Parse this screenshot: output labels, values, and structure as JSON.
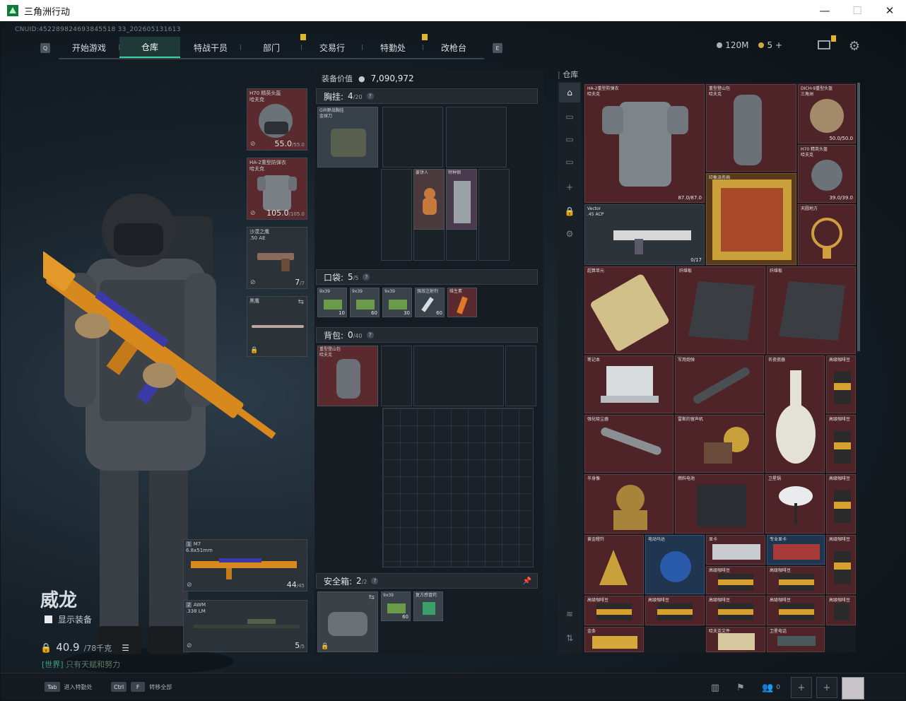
{
  "window": {
    "title": "三角洲行动",
    "min": "—",
    "max": "☐",
    "close": "✕"
  },
  "uid": "CNUID:452289824693845518 33_202605131613",
  "nav": {
    "left_key": "Q",
    "right_key": "E",
    "tabs": [
      {
        "label": "开始游戏"
      },
      {
        "label": "仓库"
      },
      {
        "label": "特战干员"
      },
      {
        "label": "部门"
      },
      {
        "label": "交易行"
      },
      {
        "label": "特勤处"
      },
      {
        "label": "改枪台"
      }
    ],
    "active_tab": "仓库"
  },
  "currency": {
    "silver": "120M",
    "gold": "5",
    "add": "+"
  },
  "character": {
    "name": "威龙",
    "show_equip_label": "显示装备",
    "weight": "40.9",
    "weight_max": "/78千克",
    "chat_tag": "[世界]",
    "chat_msg": "只有天赋和努力"
  },
  "slots": {
    "helmet": {
      "name": "H70 精英头盔\n哈夫克",
      "value": "55.0",
      "max": "/55.0"
    },
    "armor": {
      "name": "HA-2重型防弹衣\n哈夫克",
      "value": "105.0",
      "max": "/105.0"
    },
    "pistol": {
      "name": "沙漠之鹰\n.50 AE",
      "value": "7",
      "max": "/7"
    },
    "melee": {
      "name": "黑鹰"
    },
    "primary1": {
      "index": "1",
      "name": "M7",
      "ammo": "6.8x51mm",
      "value": "44",
      "max": "/45"
    },
    "primary2": {
      "index": "2",
      "name": "AWM",
      "ammo": ".338 LM",
      "value": "5",
      "max": "/5"
    }
  },
  "middle": {
    "equip_value_label": "装备价值",
    "equip_value": "7,090,972",
    "chest": {
      "label": "胸挂:",
      "count": "4",
      "max": "/20",
      "item": "GIR野战胸挂\n金球刀"
    },
    "chest_items": [
      {
        "name": "姜饼人"
      },
      {
        "name": "特种钢"
      }
    ],
    "pocket": {
      "label": "口袋:",
      "count": "5",
      "max": "/5"
    },
    "pocket_items": [
      {
        "name": "9x39",
        "qty": "10"
      },
      {
        "name": "9x39",
        "qty": "60"
      },
      {
        "name": "9x39",
        "qty": "30"
      },
      {
        "name": "强效注射剂",
        "qty": "60"
      },
      {
        "name": "维生素"
      }
    ],
    "backpack": {
      "label": "背包:",
      "count": "0",
      "max": "/40",
      "item": "重型登山包\n哈夫克"
    },
    "safe": {
      "label": "安全箱:",
      "count": "2",
      "max": "/2"
    },
    "safe_items": [
      {
        "name": "9x39",
        "qty": "60"
      },
      {
        "name": "复方感冒药"
      }
    ]
  },
  "stash": {
    "title": "仓库",
    "items": [
      {
        "name": "HA-2重型防弹衣\n哈夫克",
        "value": "87.0/87.0"
      },
      {
        "name": "重型登山包\n哈夫克"
      },
      {
        "name": "DICH-9重型头盔\n三角洲",
        "value": "50.0/50.0"
      },
      {
        "name": "H70 精英头盔\n哈夫克",
        "value": "39.0/39.0"
      },
      {
        "name": "Vector\n.45 ACP",
        "value": "0/17"
      },
      {
        "name": "印象派名画"
      },
      {
        "name": "天圆地方"
      },
      {
        "name": "超算单元"
      },
      {
        "name": "纤维板"
      },
      {
        "name": "纤维板"
      },
      {
        "name": "笔记本"
      },
      {
        "name": "军用炮弹"
      },
      {
        "name": "名瓷瓷器"
      },
      {
        "name": "高级咖啡豆"
      },
      {
        "name": "强化吸尘器"
      },
      {
        "name": "雷斯的留声机"
      },
      {
        "name": "高级咖啡豆"
      },
      {
        "name": "半身像"
      },
      {
        "name": "燃料电池"
      },
      {
        "name": "卫星锅"
      },
      {
        "name": "高级咖啡豆"
      },
      {
        "name": "黄金瞪羚"
      },
      {
        "name": "电动马达"
      },
      {
        "name": "显卡"
      },
      {
        "name": "专业显卡"
      },
      {
        "name": "高级咖啡豆"
      },
      {
        "name": "高级咖啡豆"
      },
      {
        "name": "高级咖啡豆"
      },
      {
        "name": "高级咖啡豆"
      },
      {
        "name": "高级咖啡豆"
      },
      {
        "name": "高级咖啡豆"
      },
      {
        "name": "高级咖啡豆"
      },
      {
        "name": "高级咖啡豆"
      },
      {
        "name": "金条"
      },
      {
        "name": "哈夫克文件"
      },
      {
        "name": "卫星电话"
      }
    ]
  },
  "bottom": {
    "hint1_key": "Tab",
    "hint1": "进入特勤处",
    "hint2_key1": "Ctrl",
    "hint2_key2": "F",
    "hint2": "转移全部",
    "friends": "0"
  },
  "colors": {
    "accent": "#3fd2a0",
    "item_red": "#5a2a2e",
    "flag": "#e0b72a"
  }
}
